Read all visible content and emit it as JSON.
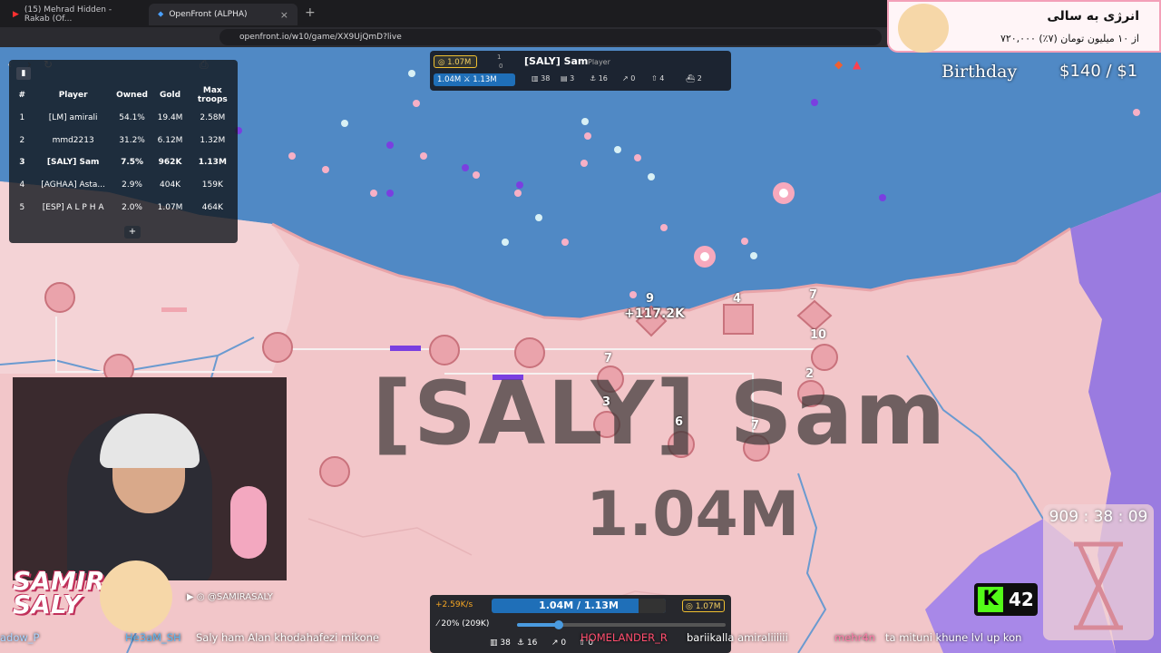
{
  "browser": {
    "tabs": [
      {
        "label": "(15) Mehrad Hidden - Rakab (Of..."
      },
      {
        "label": "OpenFront (ALPHA)"
      }
    ],
    "url": "openfront.io/w10/game/XX9UjQmD?live"
  },
  "leaderboard": {
    "headers": [
      "#",
      "Player",
      "Owned",
      "Gold",
      "Max troops"
    ],
    "rows": [
      {
        "rank": "1",
        "player": "[LM] amirali",
        "owned": "54.1%",
        "gold": "19.4M",
        "max_troops": "2.58M"
      },
      {
        "rank": "2",
        "player": "mmd2213",
        "owned": "31.2%",
        "gold": "6.12M",
        "max_troops": "1.32M"
      },
      {
        "rank": "3",
        "player": "[SALY] Sam",
        "owned": "7.5%",
        "gold": "962K",
        "max_troops": "1.13M"
      },
      {
        "rank": "4",
        "player": "[AGHAA] Asta...",
        "owned": "2.9%",
        "gold": "404K",
        "max_troops": "159K"
      },
      {
        "rank": "5",
        "player": "[ESP] A L P H A",
        "owned": "2.0%",
        "gold": "1.07M",
        "max_troops": "464K"
      }
    ],
    "expand_label": "+"
  },
  "player_panel": {
    "gold": "1.07M",
    "troops": "1.04M",
    "max_troops": "1.13M",
    "name": "[SALY] Sam",
    "type": "Player",
    "stats": [
      "38",
      "3",
      "16",
      "0",
      "4",
      "2"
    ],
    "alliance_counts": [
      "1",
      "0"
    ]
  },
  "map_labels": {
    "player_name": "[SALY] Sam",
    "player_troops": "1.04M",
    "floating_gain": "+117.2K",
    "unit_numbers": [
      "9",
      "4",
      "7",
      "10",
      "2",
      "7",
      "3",
      "6",
      "7"
    ]
  },
  "bottom_bar": {
    "rate": "+2.59K/s",
    "troops_display": "1.04M / 1.13M",
    "gold": "1.07M",
    "attack_ratio": "20% (209K)",
    "slider_fraction": 0.2,
    "stats": [
      "38",
      "16",
      "0",
      "0"
    ]
  },
  "stream": {
    "donation_title": "انرژی به سالی",
    "donation_amount": "۷۲۰,۰۰۰ از ۱۰ میلیون تومان (۷٪)",
    "birthday_text": "Birthday",
    "price_text": "$140 / $1",
    "timer": "909 : 38 : 09",
    "kick_viewers": "42",
    "brand": [
      "SAMIRA",
      "SALY"
    ],
    "social": "@SAMIRASALY",
    "chat": [
      {
        "user": "adow_P",
        "msg": ""
      },
      {
        "user": "He3aM_SH",
        "msg": "Saly ham Alan khodahafezi mikone"
      },
      {
        "user": "HOMELANDER_R",
        "msg": "bariikalla amiraliiiiii"
      },
      {
        "user": "mehr4n",
        "msg": "ta mituni khune lvl up kon"
      }
    ]
  },
  "colors": {
    "ocean": "#4f86c6",
    "land": "#f2c6c9",
    "accent_blue": "#1f6fb8",
    "gold": "#f0c030",
    "river": "#6a9ad0",
    "enemy_purple": "#9a7be0"
  }
}
